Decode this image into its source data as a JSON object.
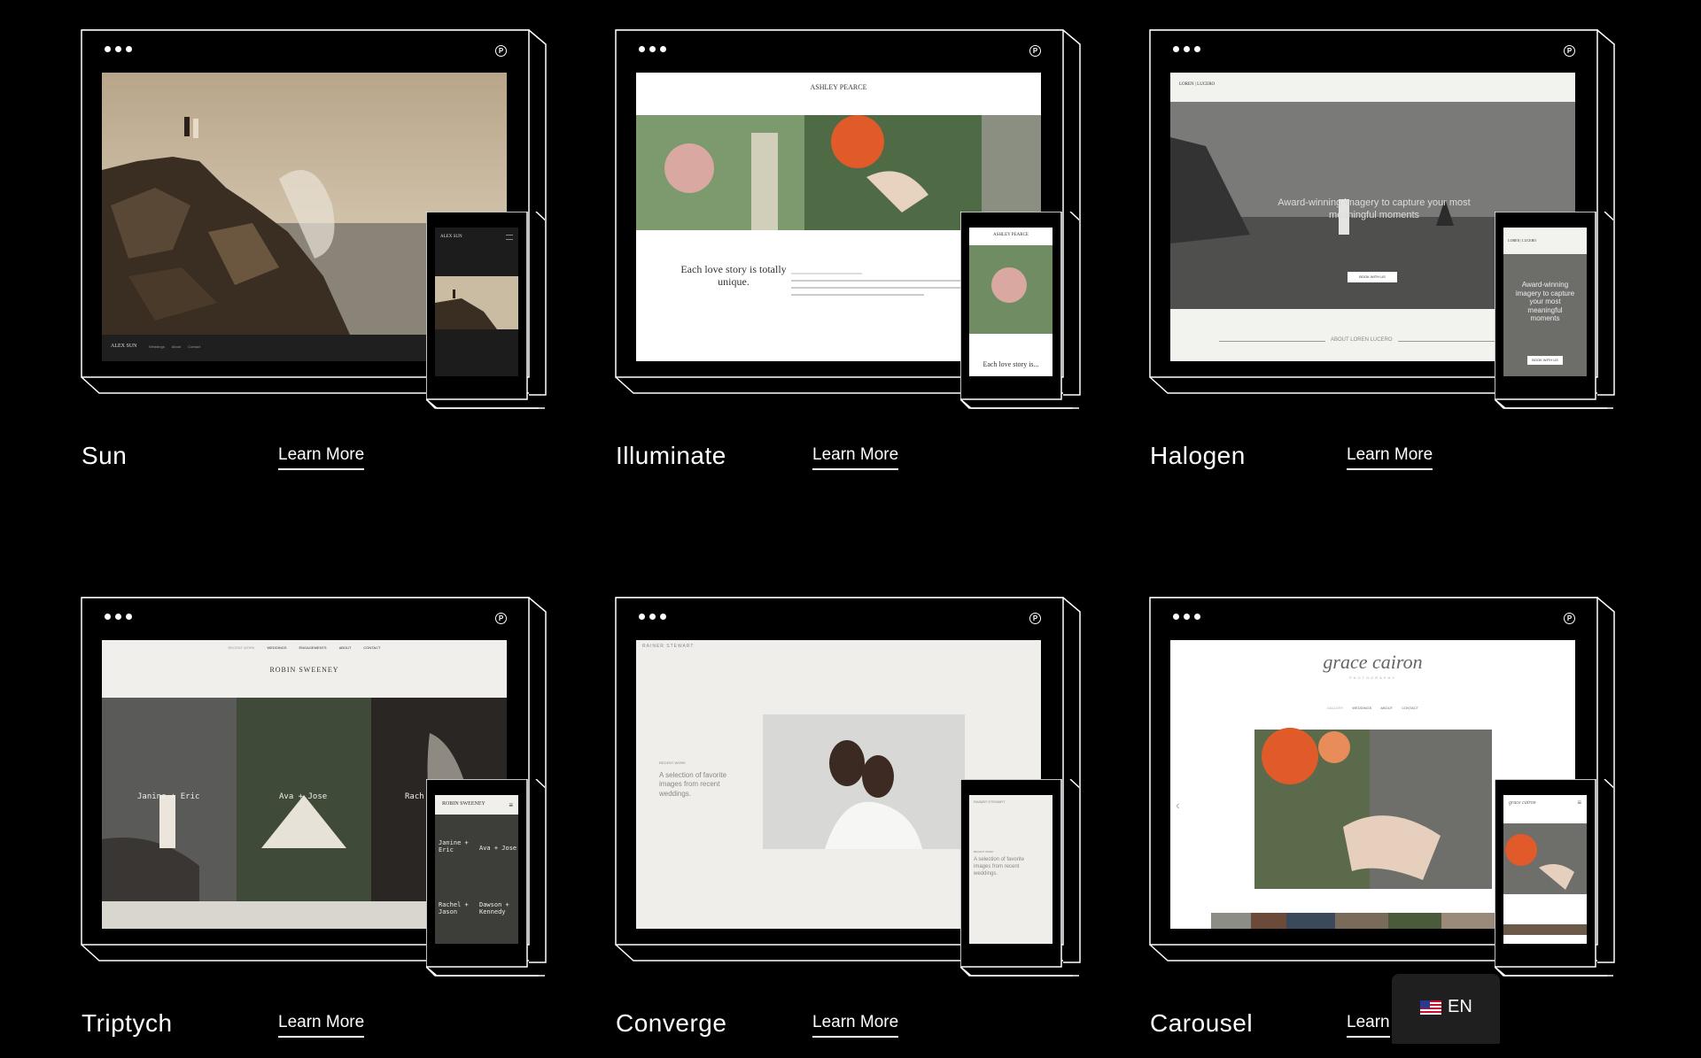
{
  "cards": [
    {
      "name": "Sun",
      "link": "Learn More",
      "site_title": "ALEX SUN",
      "nav": [
        "Weddings",
        "About",
        "Contact"
      ]
    },
    {
      "name": "Illuminate",
      "link": "Learn More",
      "site_title": "ASHLEY PEARCE",
      "heading": "Each love story is totally unique.",
      "phone_heading": "Each love story is..."
    },
    {
      "name": "Halogen",
      "link": "Learn More",
      "site_title": "LOREN | LUCERO",
      "hero": "Award-winning imagery to capture your most meaningful moments",
      "phone_hero": "Award-winning imagery to capture your most meaningful moments",
      "cta": "BOOK WITH US",
      "footer": "ABOUT LOREN LUCERO"
    },
    {
      "name": "Triptych",
      "link": "Learn More",
      "site_title": "ROBIN SWEENEY",
      "nav": [
        "RECENT WORK",
        "WEDDINGS",
        "ENGAGEMENTS",
        "ABOUT",
        "CONTACT"
      ],
      "panels": [
        "Janine + Eric",
        "Ava + Jose",
        "Rach"
      ],
      "phone_panels": [
        "Janine + Eric",
        "Ava + Jose",
        "Rachel + Jason",
        "Dawson + Kennedy"
      ]
    },
    {
      "name": "Converge",
      "link": "Learn More",
      "site_title": "RAINER STEWART",
      "label": "RECENT WORK",
      "caption": "A selection of favorite images from recent weddings."
    },
    {
      "name": "Carousel",
      "link": "Learn",
      "site_title": "grace cairon",
      "subtitle": "PHOTOGRAPHY",
      "nav": [
        "GALLERY",
        "WEDDINGS",
        "ABOUT",
        "CONTACT"
      ]
    }
  ],
  "language": {
    "label": "EN"
  },
  "colors": {
    "background": "#000000",
    "frame": "#ffffff",
    "widget": "#1f1f1f"
  }
}
